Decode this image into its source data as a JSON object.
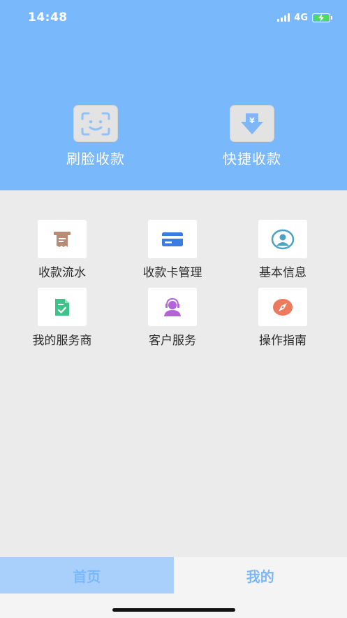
{
  "status_bar": {
    "time": "14:48",
    "network": "4G",
    "signal_icon": "signal-bars-icon",
    "battery_icon": "battery-charging-icon"
  },
  "hero": {
    "face_pay": {
      "label": "刷脸收款",
      "icon": "face-scan-icon"
    },
    "quick_pay": {
      "label": "快捷收款",
      "icon": "yuan-download-icon"
    }
  },
  "menu": {
    "items": [
      {
        "label": "收款流水",
        "icon": "receipt-printer-icon",
        "color": "#b88b75"
      },
      {
        "label": "收款卡管理",
        "icon": "bank-card-icon",
        "color": "#3b7be4"
      },
      {
        "label": "基本信息",
        "icon": "user-profile-icon",
        "color": "#4aa3c4"
      },
      {
        "label": "我的服务商",
        "icon": "checked-document-icon",
        "color": "#3ec38a"
      },
      {
        "label": "客户服务",
        "icon": "customer-service-icon",
        "color": "#b264d8"
      },
      {
        "label": "操作指南",
        "icon": "compass-icon",
        "color": "#ee7a5e"
      }
    ]
  },
  "tabbar": {
    "home_label": "首页",
    "mine_label": "我的"
  },
  "colors": {
    "header": "#78b8fb",
    "background": "#ebebeb",
    "tab_home_bg": "#a9cffb"
  }
}
